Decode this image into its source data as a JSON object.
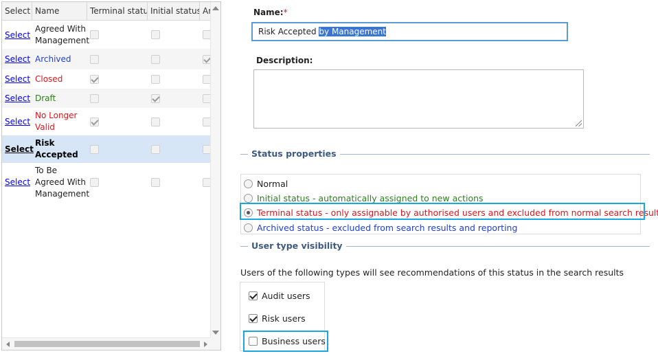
{
  "grid": {
    "columns": [
      "Select",
      "Name",
      "Terminal status",
      "Initial status",
      "Archi"
    ],
    "rows": [
      {
        "select": "Select",
        "name": "Agreed With Management",
        "terminal": false,
        "initial": false,
        "archived": false
      },
      {
        "select": "Select",
        "name": "Archived",
        "terminal": false,
        "initial": false,
        "archived": true
      },
      {
        "select": "Select",
        "name": "Closed",
        "terminal": true,
        "initial": false,
        "archived": false
      },
      {
        "select": "Select",
        "name": "Draft",
        "terminal": false,
        "initial": true,
        "archived": false
      },
      {
        "select": "Select",
        "name": "No Longer Valid",
        "terminal": true,
        "initial": false,
        "archived": false
      },
      {
        "select": "Select",
        "name": "Risk Accepted",
        "terminal": false,
        "initial": false,
        "archived": false
      },
      {
        "select": "Select",
        "name": "To Be Agreed With Management",
        "terminal": false,
        "initial": false,
        "archived": false
      }
    ]
  },
  "form": {
    "name_label": "Name:",
    "required_mark": "*",
    "name_value_plain": "Risk Accepted ",
    "name_value_selected": "by Management",
    "description_label": "Description:",
    "description_value": ""
  },
  "status_properties": {
    "title": "Status properties",
    "options": {
      "normal": "Normal",
      "initial": "Initial status - automatically assigned to new actions",
      "terminal": "Terminal status - only assignable by authorised users and excluded from normal search results",
      "archived": "Archived status - excluded from search results and reporting"
    },
    "selected": "terminal"
  },
  "user_type_visibility": {
    "title": "User type visibility",
    "info": "Users of the following types will see recommendations of this status in the search results",
    "audit_label": "Audit users",
    "audit_checked": true,
    "risk_label": "Risk users",
    "risk_checked": true,
    "business_label": "Business users",
    "business_checked": false
  },
  "colors": {
    "callout": "#19a7e0",
    "selected_row": "#d7e6f7",
    "section_title": "#3d5a80"
  }
}
